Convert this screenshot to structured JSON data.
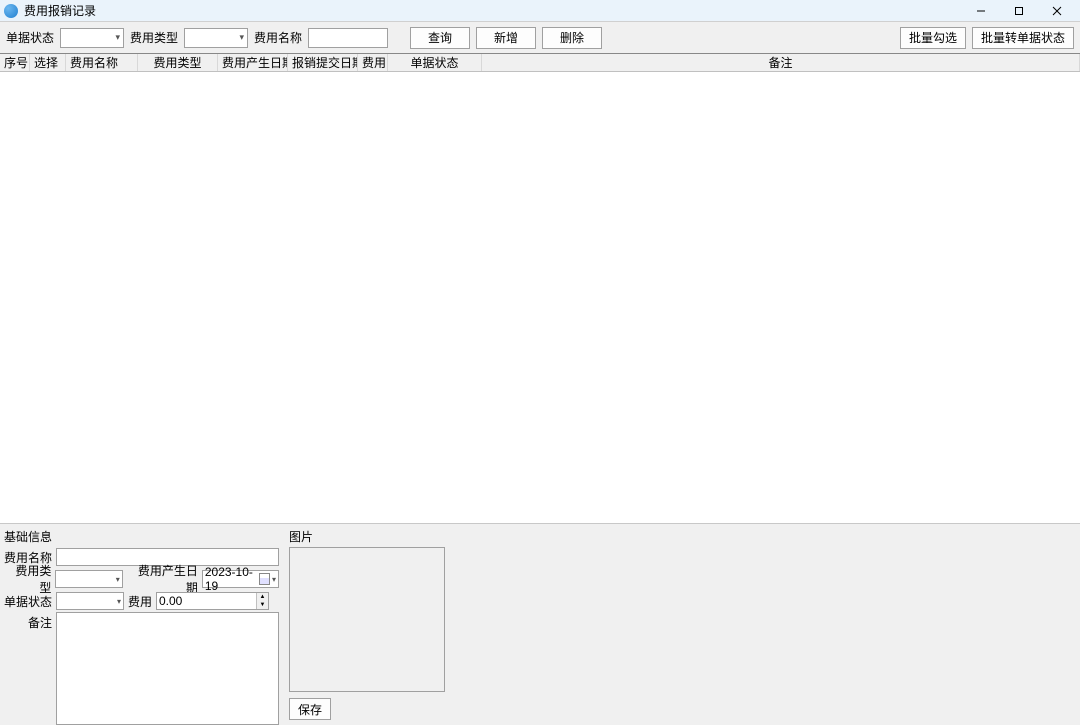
{
  "window": {
    "title": "费用报销记录"
  },
  "toolbar": {
    "status_label": "单据状态",
    "type_label": "费用类型",
    "name_label": "费用名称",
    "query_btn": "查询",
    "new_btn": "新增",
    "delete_btn": "删除",
    "batch_check_btn": "批量勾选",
    "batch_convert_btn": "批量转单据状态"
  },
  "table": {
    "headers": {
      "seq": "序号",
      "select": "选择",
      "name": "费用名称",
      "type": "费用类型",
      "gen_date": "费用产生日期",
      "submit_date": "报销提交日期",
      "fee": "费用",
      "status": "单据状态",
      "remark": "备注"
    }
  },
  "form": {
    "section": "基础信息",
    "name_label": "费用名称",
    "type_label": "费用类型",
    "gen_date_label": "费用产生日期",
    "gen_date_value": "2023-10-19",
    "status_label": "单据状态",
    "fee_label": "费用",
    "fee_value": "0.00",
    "remark_label": "备注",
    "image_section": "图片",
    "save_btn": "保存"
  }
}
